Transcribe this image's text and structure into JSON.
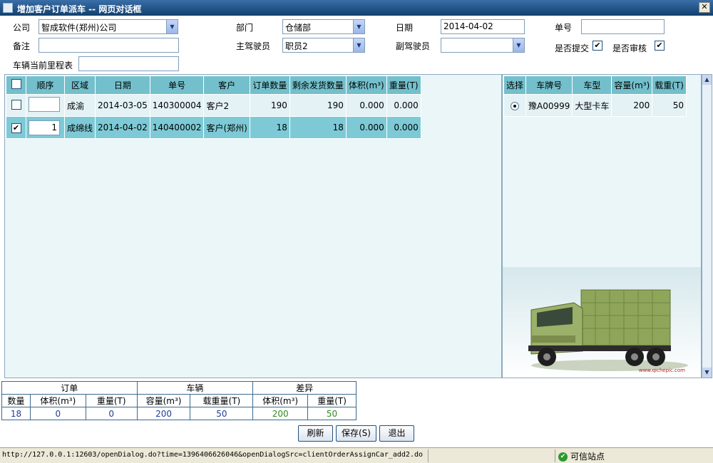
{
  "window": {
    "title": "增加客户订单派车 -- 网页对话框",
    "close": "✕"
  },
  "form": {
    "company_label": "公司",
    "company_value": "智成软件(郑州)公司",
    "dept_label": "部门",
    "dept_value": "仓储部",
    "date_label": "日期",
    "date_value": "2014-04-02",
    "order_no_label": "单号",
    "order_no_value": "",
    "remark_label": "备注",
    "remark_value": "",
    "main_driver_label": "主驾驶员",
    "main_driver_value": "职员2",
    "co_driver_label": "副驾驶员",
    "co_driver_value": "",
    "submitted_label": "是否提交",
    "submitted_checked": true,
    "audited_label": "是否审核",
    "audited_checked": true,
    "odometer_label": "车辆当前里程表",
    "odometer_value": ""
  },
  "orders": {
    "columns": [
      "顺序",
      "区域",
      "日期",
      "单号",
      "客户",
      "订单数量",
      "剩余发货数量",
      "体积(m³)",
      "重量(T)"
    ],
    "rows": [
      {
        "checked": false,
        "seq": "",
        "area": "成渝",
        "date": "2014-03-05",
        "no": "140300004",
        "customer": "客户2",
        "qty": "190",
        "remain": "190",
        "volume": "0.000",
        "weight": "0.000"
      },
      {
        "checked": true,
        "seq": "1",
        "area": "成绵线",
        "date": "2014-04-02",
        "no": "140400002",
        "customer": "客户(郑州)",
        "qty": "18",
        "remain": "18",
        "volume": "0.000",
        "weight": "0.000"
      }
    ]
  },
  "vehicles": {
    "columns": [
      "选择",
      "车牌号",
      "车型",
      "容量(m³)",
      "载重(T)"
    ],
    "rows": [
      {
        "selected": true,
        "plate": "豫A00999",
        "type": "大型卡车",
        "capacity": "200",
        "load": "50"
      }
    ],
    "image_caption": "www.qichepic.com"
  },
  "summary": {
    "groups": [
      "订单",
      "车辆",
      "差异"
    ],
    "headers": [
      "数量",
      "体积(m³)",
      "重量(T)",
      "容量(m³)",
      "载重量(T)",
      "体积(m³)",
      "重量(T)"
    ],
    "values": [
      "18",
      "0",
      "0",
      "200",
      "50",
      "200",
      "50"
    ]
  },
  "buttons": {
    "refresh": "刷新",
    "save": "保存(S)",
    "exit": "退出"
  },
  "status": {
    "url": "http://127.0.0.1:12603/openDialog.do?time=1396406626046&openDialogSrc=clientOrderAssignCar_add2.do",
    "zone": "可信站点"
  },
  "colors": {
    "header": "#73c0cc",
    "selected_row": "#7dcad6",
    "panel_bg": "#eaf6f8",
    "title_bar": "#2a5a8c"
  }
}
